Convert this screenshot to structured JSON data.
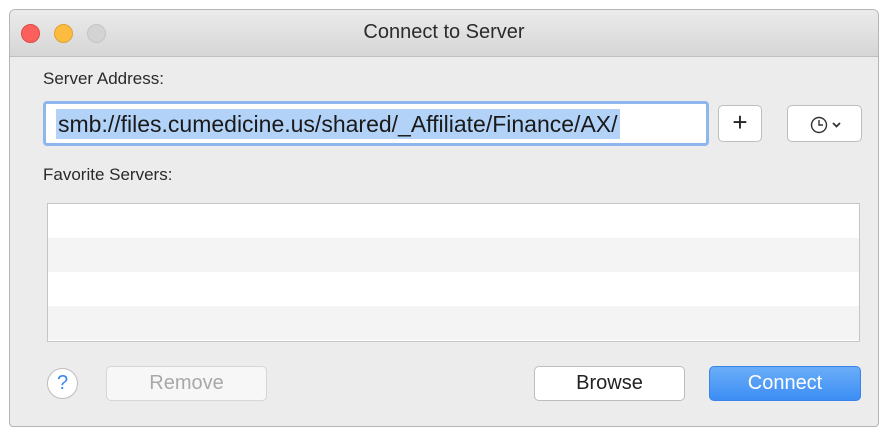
{
  "window": {
    "title": "Connect to Server"
  },
  "server_address": {
    "label": "Server Address:",
    "value": "smb://files.cumedicine.us/shared/_Affiliate/Finance/AX/"
  },
  "toolbar": {
    "add_label": "+",
    "history_icon": "clock-icon",
    "history_dropdown_icon": "chevron-down-icon"
  },
  "favorites": {
    "label": "Favorite Servers:",
    "items": []
  },
  "footer": {
    "help_label": "?",
    "remove_label": "Remove",
    "browse_label": "Browse",
    "connect_label": "Connect"
  },
  "colors": {
    "accent": "#3c8df4",
    "selection": "#b3d2f8",
    "close": "#fc605c",
    "minimize": "#fdbc40"
  }
}
